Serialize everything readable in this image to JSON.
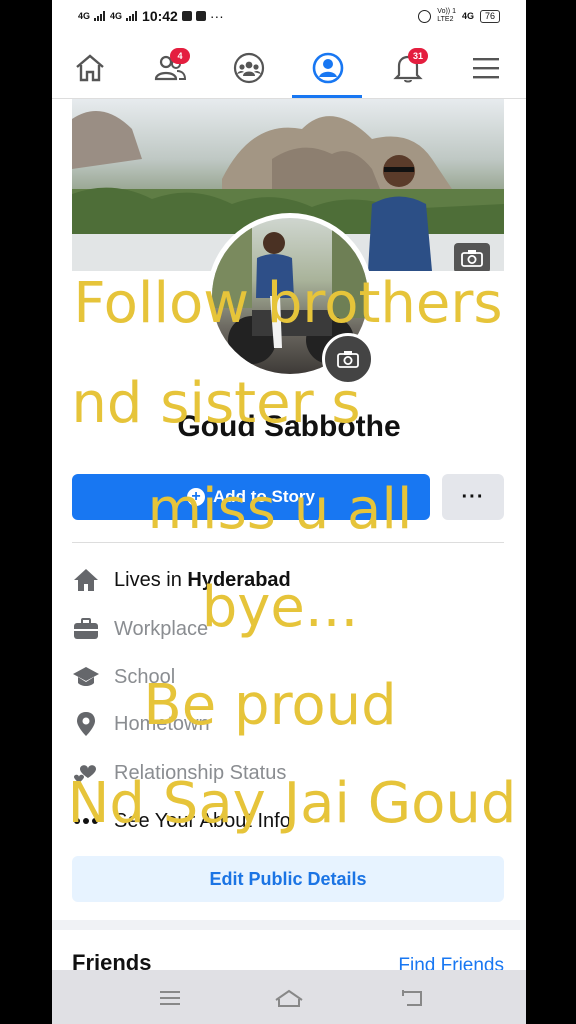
{
  "status_bar": {
    "signal_1": "4G",
    "signal_2": "4G",
    "time": "10:42",
    "dots": "···",
    "volte_top": "Vo)) 1",
    "volte_bottom": "LTE2",
    "network": "4G",
    "battery": "76"
  },
  "nav": {
    "friends_badge": "4",
    "notifications_badge": "31",
    "active_tab": "profile",
    "accent_color": "#1877f2"
  },
  "profile": {
    "name": "Goud Sabbothe",
    "add_story_label": "Add to Story",
    "more_label": "···"
  },
  "details": [
    {
      "icon": "home-icon",
      "prefix": "Lives in ",
      "value": "Hyderabad"
    },
    {
      "icon": "briefcase-icon",
      "prefix": "",
      "value": "Workplace"
    },
    {
      "icon": "graduation-cap-icon",
      "prefix": "",
      "value": "School"
    },
    {
      "icon": "location-pin-icon",
      "prefix": "",
      "value": "Hometown"
    },
    {
      "icon": "hearts-icon",
      "prefix": "",
      "value": "Relationship Status"
    },
    {
      "icon": "dots-icon",
      "prefix": "",
      "value": "See Your About Info"
    }
  ],
  "edit_public_details_label": "Edit Public Details",
  "friends": {
    "title": "Friends",
    "find_friends_label": "Find Friends"
  },
  "overlay_caption": [
    "Follow brothers",
    "nd sister s",
    "miss u all",
    "bye...",
    "Be proud",
    "Nd Say Jai Goud"
  ],
  "overlay_color": "#e6c43a"
}
